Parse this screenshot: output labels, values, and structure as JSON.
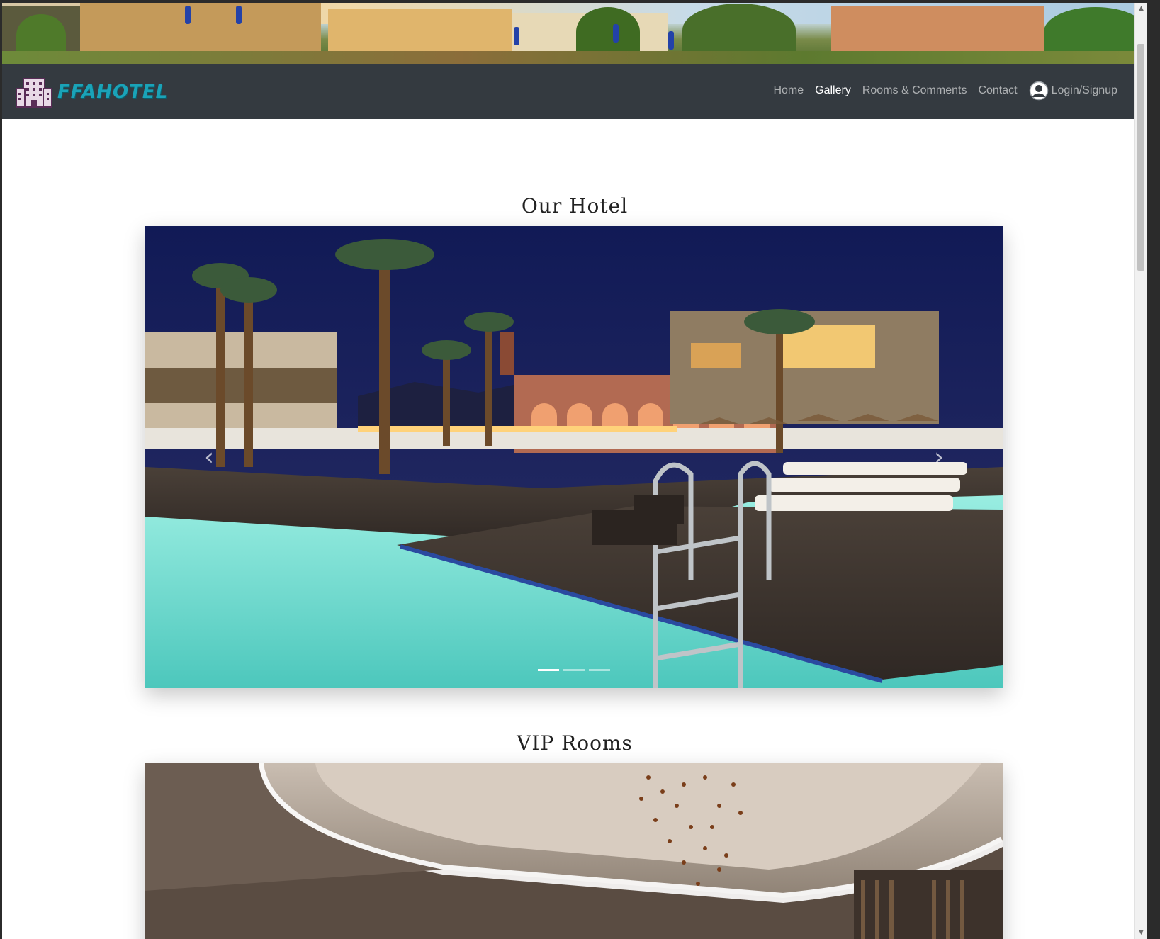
{
  "brand": {
    "name": "FFAHOTEL",
    "icon": "hotel-building-icon"
  },
  "nav": {
    "items": [
      {
        "label": "Home",
        "active": false
      },
      {
        "label": "Gallery",
        "active": true
      },
      {
        "label": "Rooms & Comments",
        "active": false
      },
      {
        "label": "Contact",
        "active": false
      }
    ],
    "login": {
      "label": "Login/Signup",
      "icon": "user-circle-icon"
    }
  },
  "sections": [
    {
      "title": "Our Hotel",
      "slides": 3,
      "active_slide": 1,
      "image": "night-pool-resort"
    },
    {
      "title": "VIP Rooms",
      "image": "luxury-room-chandelier"
    }
  ],
  "carousel_controls": {
    "prev_icon": "chevron-left-icon",
    "next_icon": "chevron-right-icon"
  },
  "colors": {
    "navbar": "#343a40",
    "brand": "#1aa3b8",
    "nav_link": "rgba(255,255,255,0.6)",
    "nav_active": "#ffffff"
  }
}
